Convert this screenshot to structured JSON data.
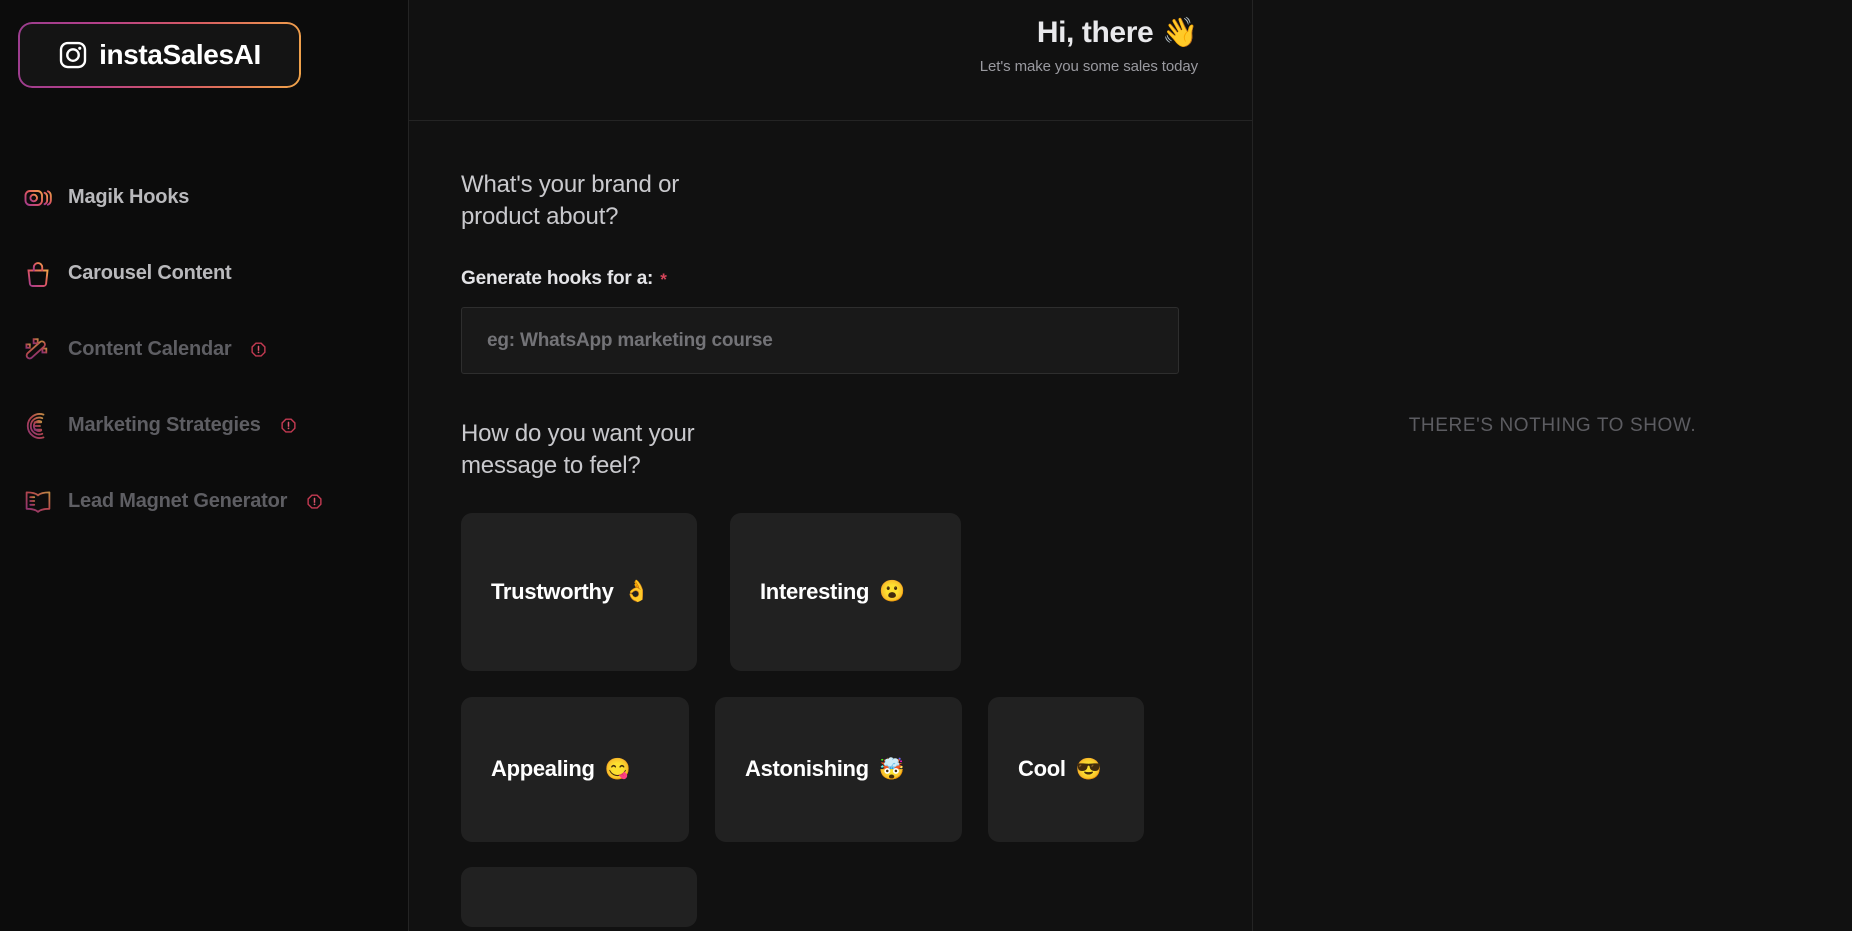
{
  "app": {
    "logo_text": "instaSalesAI",
    "logo_icon": "instagram-camera-icon"
  },
  "sidebar": {
    "items": [
      {
        "label": "Magik Hooks",
        "icon": "instagram-stack-icon",
        "badge": null,
        "active": true
      },
      {
        "label": "Carousel Content",
        "icon": "shopping-bag-icon",
        "badge": null,
        "active": true
      },
      {
        "label": "Content Calendar",
        "icon": "magic-wand-icon",
        "badge": "info-badge-icon",
        "active": false
      },
      {
        "label": "Marketing Strategies",
        "icon": "spiral-document-icon",
        "badge": "info-badge-icon",
        "active": false
      },
      {
        "label": "Lead Magnet Generator",
        "icon": "open-book-icon",
        "badge": "info-badge-icon",
        "active": false
      }
    ]
  },
  "header": {
    "greeting": "Hi, there",
    "wave_emoji": "👋",
    "subgreeting": "Let's make you some sales today"
  },
  "form": {
    "question_one": "What's your brand or product about?",
    "field_label": "Generate hooks for a:",
    "required_mark": "*",
    "input_value": "",
    "input_placeholder": "eg: WhatsApp marketing course",
    "question_two": "How do you want your message to feel?",
    "tones": [
      {
        "label": "Trustworthy",
        "emoji": "👌"
      },
      {
        "label": "Interesting",
        "emoji": "😮"
      },
      {
        "label": "Appealing",
        "emoji": "😋"
      },
      {
        "label": "Astonishing",
        "emoji": "🤯"
      },
      {
        "label": "Cool",
        "emoji": "😎"
      }
    ]
  },
  "right_panel": {
    "empty_message": "THERE'S NOTHING TO SHOW."
  },
  "colors": {
    "background": "#111111",
    "sidebar_background": "#0c0c0c",
    "card_background": "#212121",
    "divider": "#242424",
    "gradient_start": "#9b3d8f",
    "gradient_end": "#f0a44a",
    "required_red": "#d6455a",
    "badge_red": "#c43a52"
  }
}
